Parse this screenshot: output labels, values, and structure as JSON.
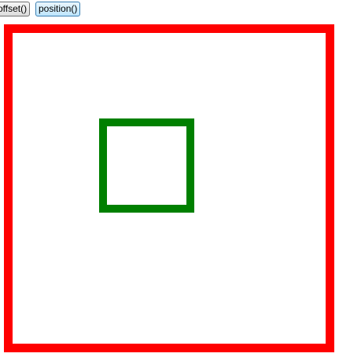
{
  "buttons": {
    "offset_label": "offset()",
    "position_label": "position()"
  },
  "colors": {
    "outer_border": "#ff0000",
    "inner_border": "#008000"
  }
}
